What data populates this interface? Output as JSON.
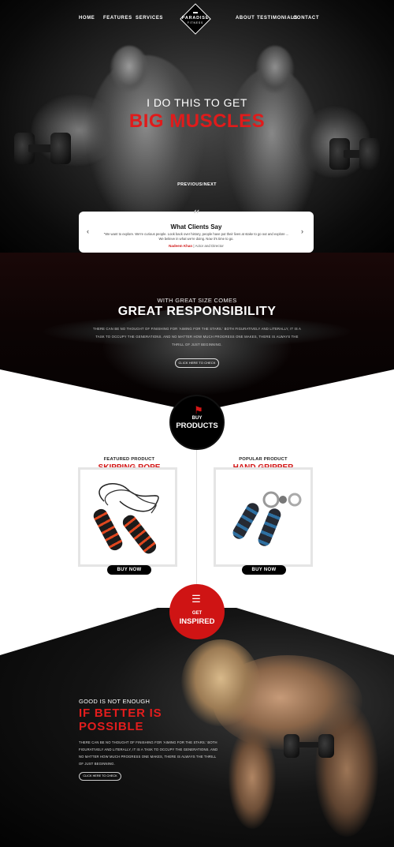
{
  "nav": {
    "left": [
      "HOME",
      "FEATURES",
      "SERVICES"
    ],
    "right": [
      "ABOUT",
      "TESTIMONIALS",
      "CONTACT"
    ],
    "logo_name": "PARADISE",
    "logo_sub": "FITNESS"
  },
  "hero": {
    "line1": "I DO THIS TO GET",
    "line2": "BIG MUSCLES",
    "pager": "PREVIOUS/NEXT"
  },
  "testimonial": {
    "title": "What Clients Say",
    "text": "\"We want to explore. We're curious people. Look back over history, people have put their lives at stake to go out and explore ... We believe in what we're doing. Now it's time to go.",
    "author": "Nadeem Khan",
    "author_role": "| Actor and Director"
  },
  "responsibility": {
    "small": "WITH GREAT SIZE COMES",
    "big": "GREAT RESPONSIBILITY",
    "text": "THERE CAN BE NO THOUGHT OF FINISHING FOR 'AIMING FOR THE STARS.' BOTH FIGURATIVELY AND LITERALLY, IT IS A TASK TO OCCUPY THE GENERATIONS. AND NO MATTER HOW MUCH PROGRESS ONE MAKES, THERE IS ALWAYS THE THRILL OF JUST BEGINNING.",
    "button": "CLICK HERE TO CHECK"
  },
  "buy_badge": {
    "small": "BUY",
    "big": "PRODUCTS"
  },
  "products": [
    {
      "label": "FEATURED PRODUCT",
      "name": "SKIPPING ROPE",
      "button": "BUY NOW"
    },
    {
      "label": "POPULAR PRODUCT",
      "name": "HAND GRIPPER",
      "button": "BUY NOW"
    }
  ],
  "inspired_badge": {
    "small": "GET",
    "big": "INSPIRED"
  },
  "inspired": {
    "small": "GOOD IS NOT ENOUGH",
    "big1": "IF BETTER IS",
    "big2": "POSSIBLE",
    "text": "THERE CAN BE NO THOUGHT OF FINISHING FOR 'AIMING FOR THE STARS.' BOTH FIGURATIVELY AND LITERALLY, IT IS A TASK TO OCCUPY THE GENERATIONS. AND NO MATTER HOW MUCH PROGRESS ONE MAKES, THERE IS ALWAYS THE THRILL OF JUST BEGINNING.",
    "button": "CLICK HERE TO CHECK"
  },
  "colors": {
    "accent": "#d31717",
    "dark": "#000000",
    "frame": "#e5e5e5"
  }
}
